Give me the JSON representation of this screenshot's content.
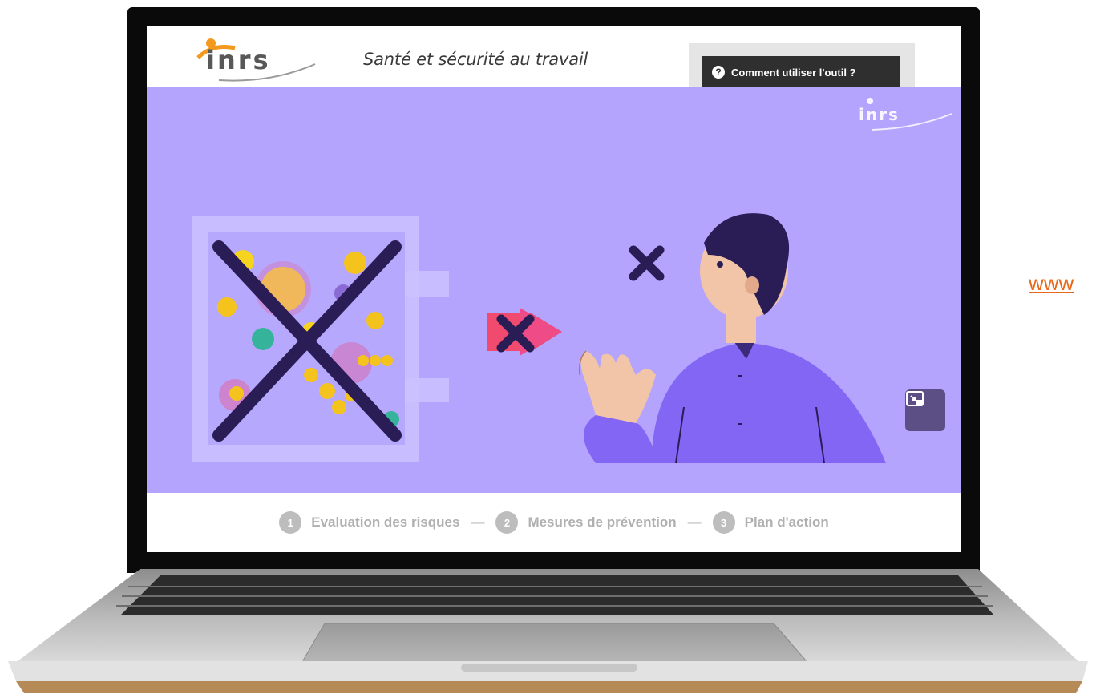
{
  "header": {
    "logo_text": "inrs",
    "tagline": "Santé et sécurité au travail",
    "help_button": {
      "icon": "question-circle-icon",
      "label": "Comment utiliser l'outil ?"
    }
  },
  "video": {
    "watermark": "inrs",
    "pip_button_icon": "picture-in-picture-icon"
  },
  "steps": [
    {
      "num": "1",
      "label": "Evaluation des risques"
    },
    {
      "num": "2",
      "label": "Mesures de prévention"
    },
    {
      "num": "3",
      "label": "Plan d'action"
    }
  ],
  "separator": "—",
  "side_link": "www",
  "colors": {
    "video_bg": "#b4a4fd",
    "accent_orange": "#e8681c",
    "header_dark": "#2f2f2f",
    "step_gray": "#bdbdbd"
  }
}
